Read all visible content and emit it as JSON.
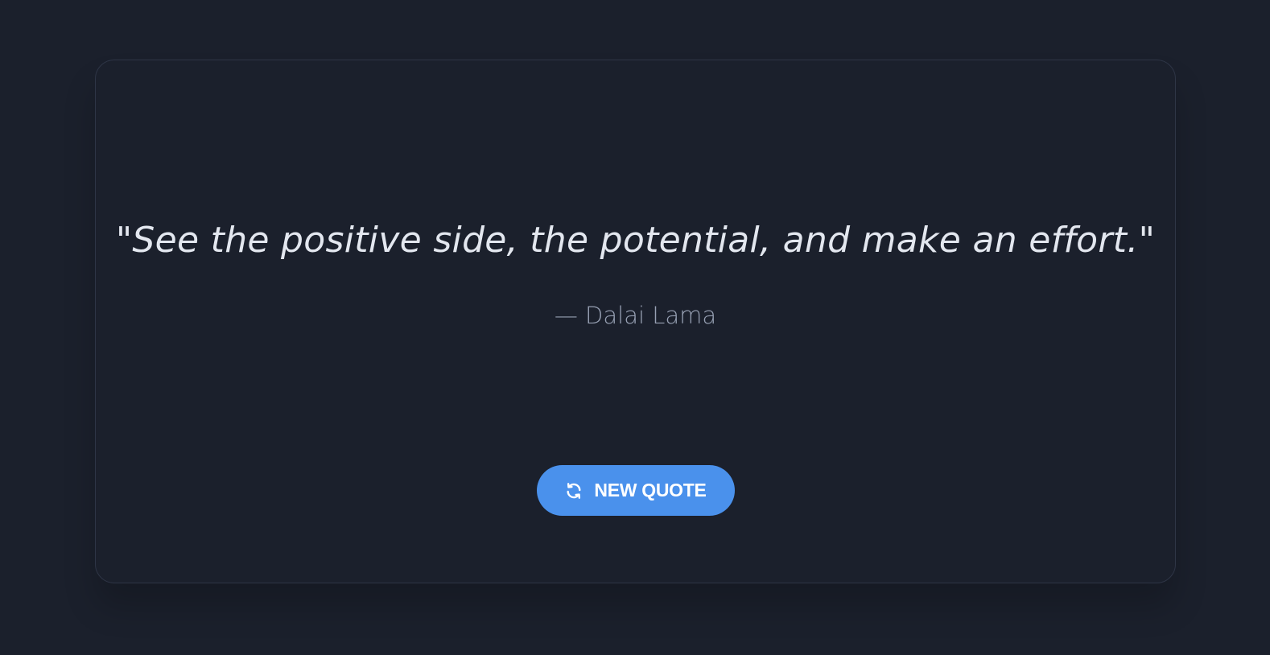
{
  "quote": {
    "text": "\"See the positive side, the potential, and make an effort.\"",
    "author": "— Dalai Lama"
  },
  "button": {
    "label": "NEW QUOTE",
    "icon": "refresh-icon"
  },
  "colors": {
    "background": "#1b202c",
    "card_border": "#2e3546",
    "quote_text": "#e3e7ef",
    "author_text": "#97a0b3",
    "accent": "#4a91ec"
  }
}
